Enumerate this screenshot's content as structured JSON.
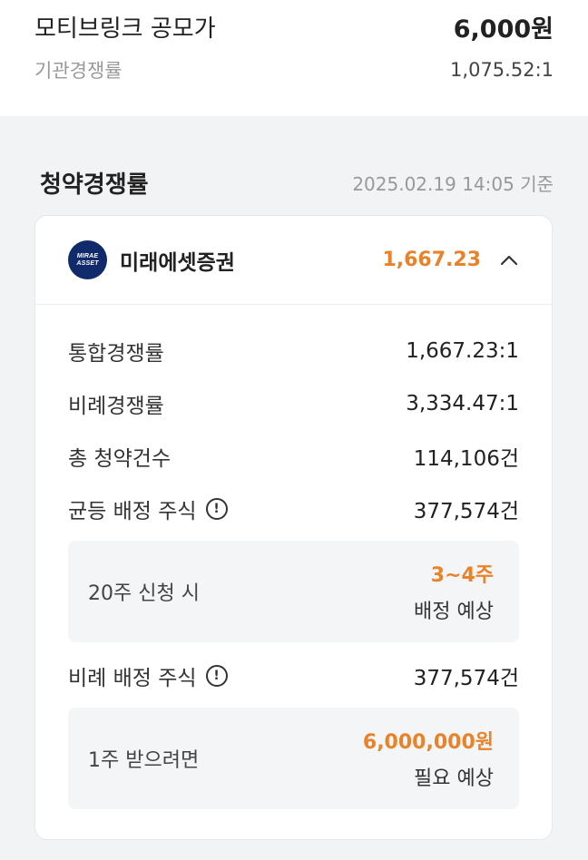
{
  "top": {
    "name": "모티브링크 공모가",
    "price": "6,000원",
    "inst_label": "기관경쟁률",
    "inst_value": "1,075.52:1"
  },
  "section": {
    "title": "청약경쟁률",
    "basis": "2025.02.19 14:05 기준"
  },
  "card": {
    "logo_line1": "MIRAE",
    "logo_line2": "ASSET",
    "broker": "미래에셋증권",
    "rate": "1,667.23",
    "accent_color": "#e8832a",
    "expand_icon": "chevron-up-icon",
    "rows": [
      {
        "label": "통합경쟁률",
        "value": "1,667.23:1"
      },
      {
        "label": "비례경쟁률",
        "value": "3,334.47:1"
      },
      {
        "label": "총 청약건수",
        "value": "114,106건"
      },
      {
        "label": "균등 배정 주식",
        "value": "377,574건"
      }
    ],
    "equal_box": {
      "label": "20주 신청 시",
      "highlight": "3~4주",
      "sub": "배정 예상"
    },
    "prop_row": {
      "label": "비례 배정 주식",
      "value": "377,574건"
    },
    "prop_box": {
      "label": "1주 받으려면",
      "highlight": "6,000,000원",
      "sub": "필요 예상"
    }
  }
}
